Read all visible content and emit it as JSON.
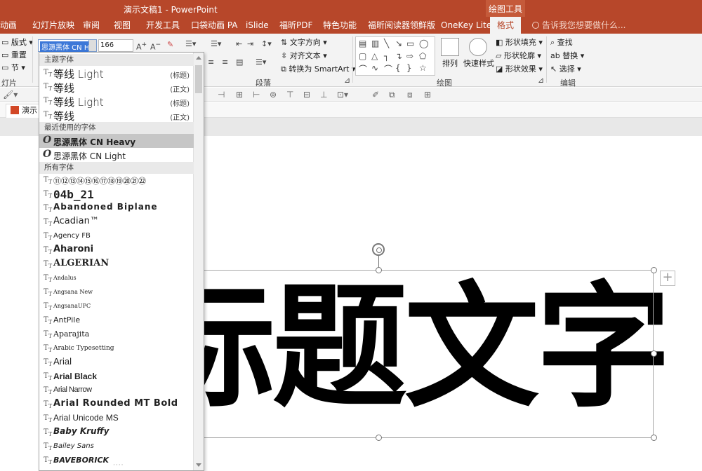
{
  "window": {
    "title": "演示文稿1 - PowerPoint",
    "context_tab_group": "绘图工具"
  },
  "tabs": [
    "动画",
    "幻灯片放映",
    "审阅",
    "视图",
    "开发工具",
    "口袋动画 PA",
    "iSlide",
    "福昕PDF",
    "特色功能",
    "福昕阅读器领鲜版",
    "OneKey Lite",
    "格式"
  ],
  "tell_me": "告诉我您想要做什么...",
  "ribbon": {
    "slides": {
      "layout": "版式",
      "reset": "重置",
      "section": "节",
      "group": "灯片"
    },
    "font": {
      "name": "思源黑体 CN He",
      "size": "166"
    },
    "paragraph": {
      "text_direction": "文字方向",
      "align_text": "对齐文本",
      "convert_smartart": "转换为 SmartArt",
      "group": "段落"
    },
    "drawing": {
      "arrange": "排列",
      "quick_styles": "快速样式",
      "shape_fill": "形状填充",
      "shape_outline": "形状轮廓",
      "shape_effects": "形状效果",
      "group": "绘图"
    },
    "editing": {
      "find": "查找",
      "replace": "替换",
      "select": "选择",
      "group": "编辑"
    }
  },
  "file_tab": "演示",
  "font_dropdown": {
    "theme_fonts_header": "主题字体",
    "theme_fonts": [
      {
        "name": "等线 Light",
        "tag": "(标题)"
      },
      {
        "name": "等线",
        "tag": "(正文)"
      },
      {
        "name": "等线 Light",
        "tag": "(标题)"
      },
      {
        "name": "等线",
        "tag": "(正文)"
      }
    ],
    "recent_header": "最近使用的字体",
    "recent_fonts": [
      "思源黑体 CN Heavy",
      "思源黑体 CN Light"
    ],
    "all_header": "所有字体",
    "all_fonts": [
      "⑪⑫⑬⑭⑮⑯⑰⑱⑲⑳㉑㉒",
      "04b_21",
      "Abandoned Biplane",
      "Acadian™",
      "Agency FB",
      "Aharoni",
      "ALGERIAN",
      "Andalus",
      "Angsana New",
      "AngsanaUPC",
      "AntPile",
      "Aparajita",
      "Arabic Typesetting",
      "Arial",
      "Arial Black",
      "Arial Narrow",
      "Arial Rounded MT Bold",
      "Arial Unicode MS",
      "Baby Kruffy",
      "Bailey Sans",
      "BAVEBORICK"
    ]
  },
  "slide": {
    "title_text": "标题文字"
  }
}
